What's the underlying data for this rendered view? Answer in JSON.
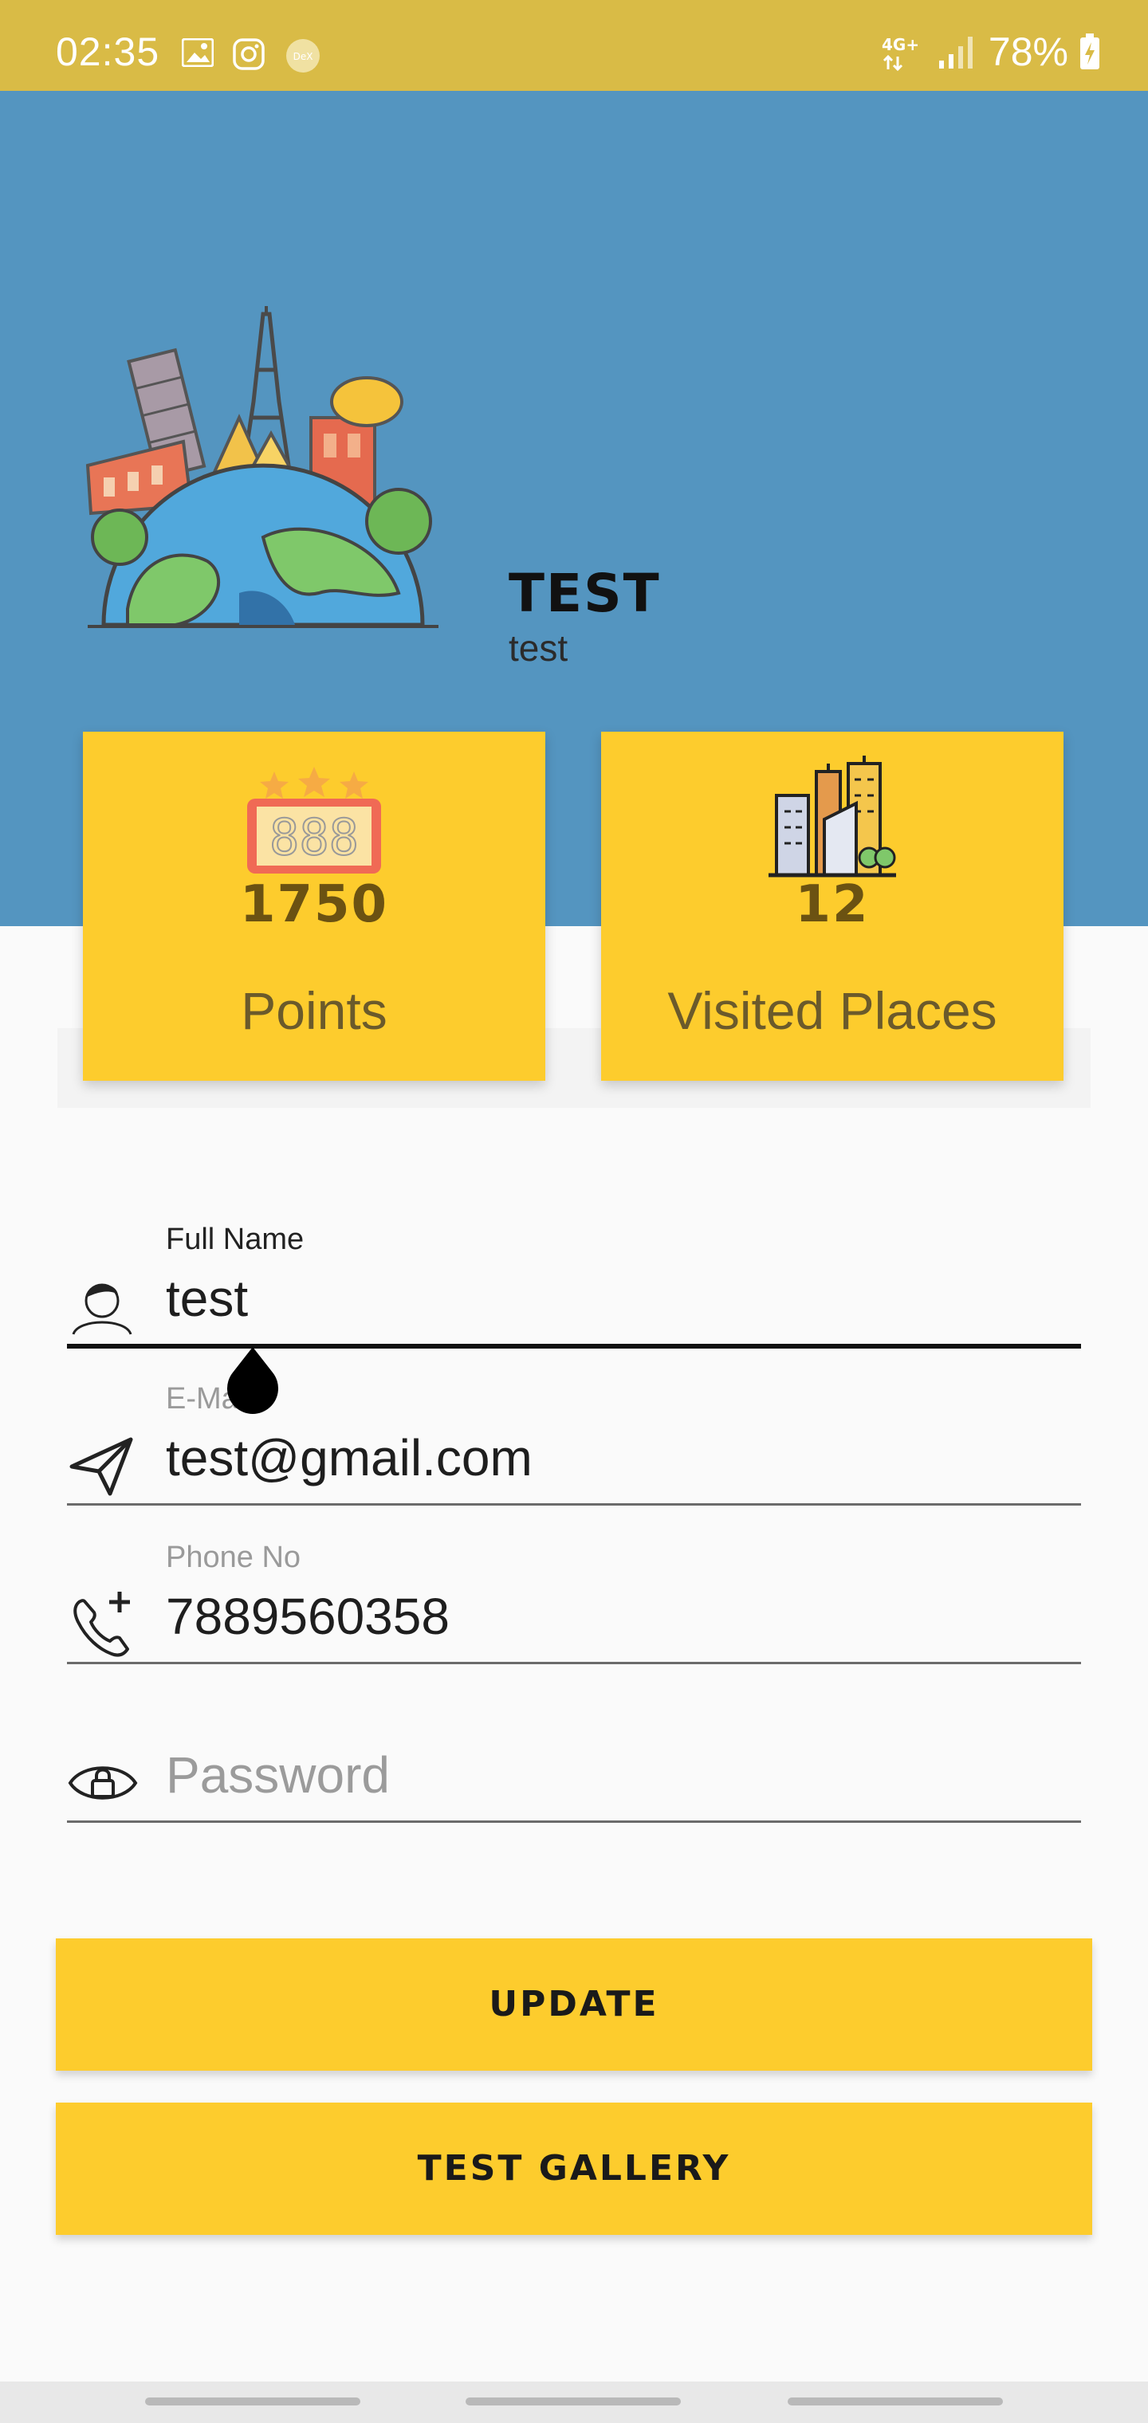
{
  "status_bar": {
    "time": "02:35",
    "network": "4G+",
    "battery": "78%",
    "notification_icons": [
      "gallery-icon",
      "instagram-icon",
      "dex-icon"
    ],
    "dex_label": "DeX"
  },
  "profile": {
    "name": "TEST",
    "username": "test"
  },
  "stats": {
    "points": {
      "value": "1750",
      "label": "Points",
      "icon": "scoreboard-icon",
      "display": "888"
    },
    "visited": {
      "value": "12",
      "label": "Visited Places",
      "icon": "city-buildings-icon"
    }
  },
  "form": {
    "full_name": {
      "label": "Full Name",
      "value": "test",
      "icon": "user-icon"
    },
    "email": {
      "label": "E-Mail",
      "value": "test@gmail.com",
      "icon": "send-icon"
    },
    "phone": {
      "label": "Phone No",
      "value": "7889560358",
      "icon": "phone-add-icon"
    },
    "password": {
      "placeholder": "Password",
      "icon": "lock-eye-icon"
    }
  },
  "buttons": {
    "update": "UPDATE",
    "gallery": "TEST GALLERY"
  },
  "colors": {
    "status_bar": "#d9bb46",
    "header": "#5495c0",
    "accent": "#fdcc2d",
    "background": "#fafafa"
  }
}
